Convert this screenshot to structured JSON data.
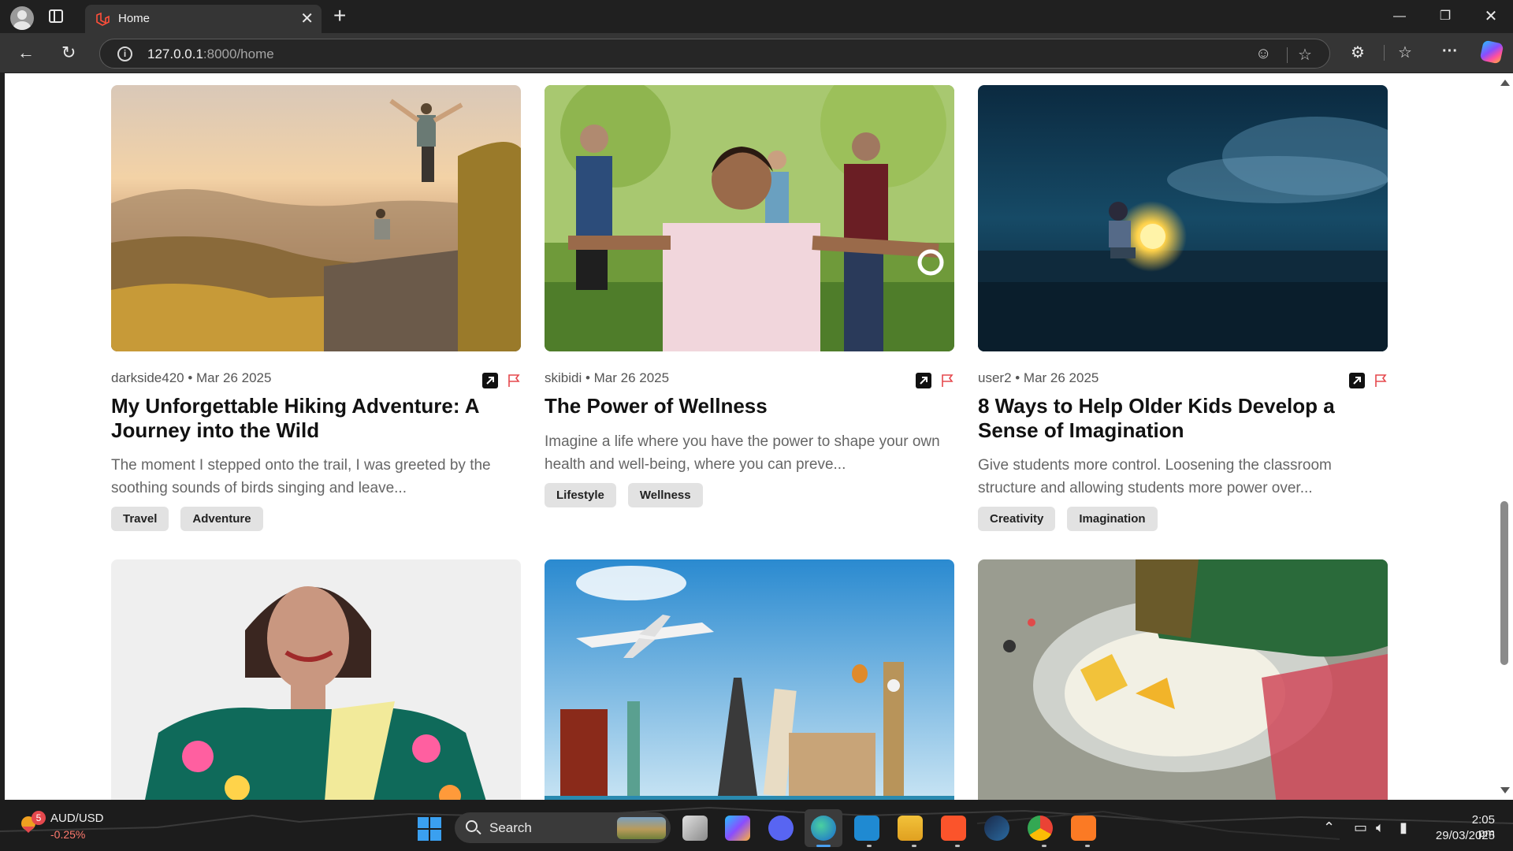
{
  "browser": {
    "tab_title": "Home",
    "url_host": "127.0.0.1",
    "url_path": ":8000/home"
  },
  "posts": [
    {
      "author": "darkside420",
      "date": "Mar 26 2025",
      "meta": "darkside420 • Mar 26 2025",
      "title": "My Unforgettable Hiking Adventure: A Journey into the Wild",
      "excerpt": "The moment I stepped onto the trail, I was greeted by the soothing sounds of birds singing and leave...",
      "tags": [
        "Travel",
        "Adventure"
      ]
    },
    {
      "author": "skibidi",
      "date": "Mar 26 2025",
      "meta": "skibidi • Mar 26 2025",
      "title": "The Power of Wellness",
      "excerpt": "Imagine a life where you have the power to shape your own health and well-being, where you can preve...",
      "tags": [
        "Lifestyle",
        "Wellness"
      ]
    },
    {
      "author": "user2",
      "date": "Mar 26 2025",
      "meta": "user2 • Mar 26 2025",
      "title": "8 Ways to Help Older Kids Develop a Sense of Imagination",
      "excerpt": "Give students more control. Loosening the classroom structure and allowing students more power over...",
      "tags": [
        "Creativity",
        "Imagination"
      ]
    }
  ],
  "taskbar": {
    "ticker_name": "AUD/USD",
    "ticker_value": "-0.25%",
    "badge_count": "5",
    "search_label": "Search",
    "time": "2:05 pm",
    "date": "29/03/2025"
  },
  "colors": {
    "flag": "#e5484d",
    "tag_bg": "#e2e2e2"
  }
}
